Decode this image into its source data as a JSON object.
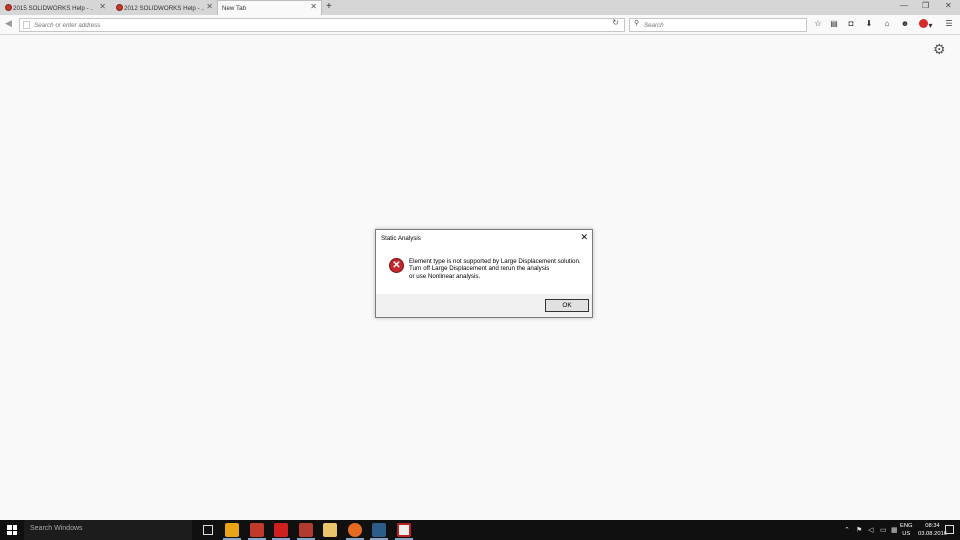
{
  "browser": {
    "tabs": [
      {
        "label": "2015 SOLIDWORKS Help - ...",
        "active": false
      },
      {
        "label": "2012 SOLIDWORKS Help - ...",
        "active": false
      },
      {
        "label": "New Tab",
        "active": true
      }
    ],
    "url_placeholder": "Search or enter address",
    "search_placeholder": "Search"
  },
  "dialog": {
    "title": "Static Analysis",
    "message_lines": [
      "Element type is not supported by Large Displacement solution.",
      "Turn off Large Displacement and rerun the analysis",
      "or use Nonlinear analysis."
    ],
    "ok_label": "OK"
  },
  "taskbar": {
    "search_placeholder": "Search Windows",
    "lang_top": "ENG",
    "lang_bottom": "US",
    "time": "08:34",
    "date": "03.08.2016"
  }
}
